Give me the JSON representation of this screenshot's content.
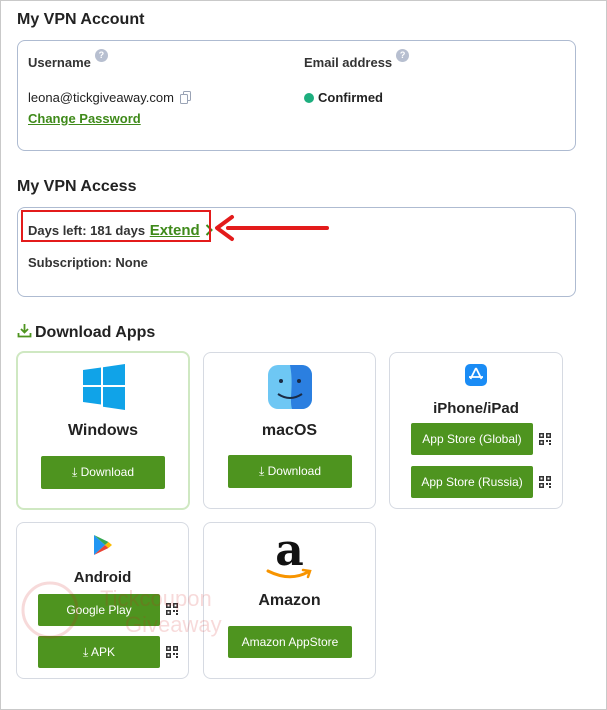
{
  "account": {
    "title": "My VPN Account",
    "username_label": "Username",
    "username_help": "?",
    "email_label": "Email address",
    "email_help": "?",
    "username_value": "leona@tickgiveaway.com",
    "email_status": "Confirmed",
    "change_password": "Change Password",
    "status_color": "#1dae7e"
  },
  "access": {
    "title": "My VPN Access",
    "days_left": "Days left: 181 days",
    "extend_label": "Extend",
    "subscription": "Subscription: None"
  },
  "downloads": {
    "title": "Download Apps",
    "apps": [
      {
        "name": "Windows",
        "buttons": [
          "Download"
        ]
      },
      {
        "name": "macOS",
        "buttons": [
          "Download"
        ]
      },
      {
        "name": "iPhone/iPad",
        "buttons": [
          "App Store (Global)",
          "App Store (Russia)"
        ]
      },
      {
        "name": "Android",
        "buttons": [
          "Google Play",
          "APK"
        ]
      },
      {
        "name": "Amazon",
        "buttons": [
          "Amazon AppStore"
        ]
      }
    ]
  },
  "watermark": {
    "line1": "Tickcoupon",
    "line2": "Giveaway"
  },
  "colors": {
    "accent": "#4e941f",
    "border": "#aebbd1",
    "highlight": "#e31b1b"
  }
}
